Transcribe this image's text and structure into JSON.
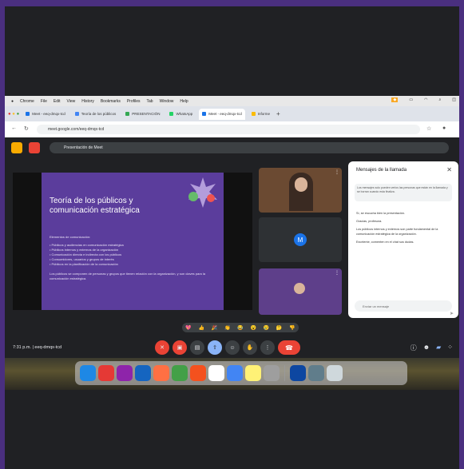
{
  "mac_menu": [
    "",
    "Chrome",
    "File",
    "Edit",
    "View",
    "History",
    "Bookmarks",
    "Profiles",
    "Tab",
    "Window",
    "Help"
  ],
  "tabs": [
    {
      "label": "Meet - eeq-dmqx-tcd",
      "color": "#1a73e8",
      "active": false
    },
    {
      "label": "Teoría de los públicos",
      "color": "#4285f4",
      "active": false
    },
    {
      "label": "PRESENTACIÓN",
      "color": "#34a853",
      "active": false
    },
    {
      "label": "WhatsApp",
      "color": "#25d366",
      "active": false
    },
    {
      "label": "Meet - eeq-dmqx-tcd",
      "color": "#1a73e8",
      "active": true
    },
    {
      "label": "Informe",
      "color": "#fbbc04",
      "active": false
    }
  ],
  "url": "meet.google.com/eeq-dmqx-tcd",
  "meet": {
    "presentation_title": "Presentación de Meet",
    "slide": {
      "title": "Teoría de los públicos y comunicación estratégica",
      "subtitle": "Elementos de comunicación:",
      "list": [
        "• Públicos y audiencias en comunicación estratégica",
        "• Públicos internos y externos de la organización",
        "• Comunicación directa e indirecta con los públicos",
        "• Consumidores, usuarios y grupos de interés",
        "• Públicos en la planificación de la comunicación"
      ],
      "footer": "Los públicos se componen de personas y grupos que tienen relación con la organización, y son claves para la comunicación estratégica."
    },
    "tiles": [
      {
        "name": "",
        "type": "video"
      },
      {
        "name": "M",
        "type": "avatar"
      },
      {
        "name": "",
        "type": "video"
      }
    ],
    "chat": {
      "title": "Mensajes de la llamada",
      "close": "✕",
      "notice": "Los mensajes solo pueden verlos las personas que están en la llamada y se borran cuando esta finaliza.",
      "messages": [
        "Sí, se escucha bien la presentación.",
        "Gracias, profesora.",
        "Los públicos internos y externos son parte fundamental de la comunicación estratégica de la organización.",
        "Excelente, comenten en el chat sus dudas."
      ],
      "input_placeholder": "Enviar un mensaje"
    },
    "reactions": [
      "💖",
      "👍",
      "🎉",
      "👏",
      "😂",
      "😮",
      "😢",
      "🤔",
      "👎"
    ],
    "clock": "7:31 p.m.  |  eeq-dmqx-tcd"
  },
  "dock_colors": [
    "#1e88e5",
    "#e53935",
    "#8e24aa",
    "#1565c0",
    "#ff7043",
    "#43a047",
    "#f4511e",
    "#ffffff",
    "#4285f4",
    "#fff176",
    "#9e9e9e",
    "#0d47a1",
    "#607d8b"
  ]
}
